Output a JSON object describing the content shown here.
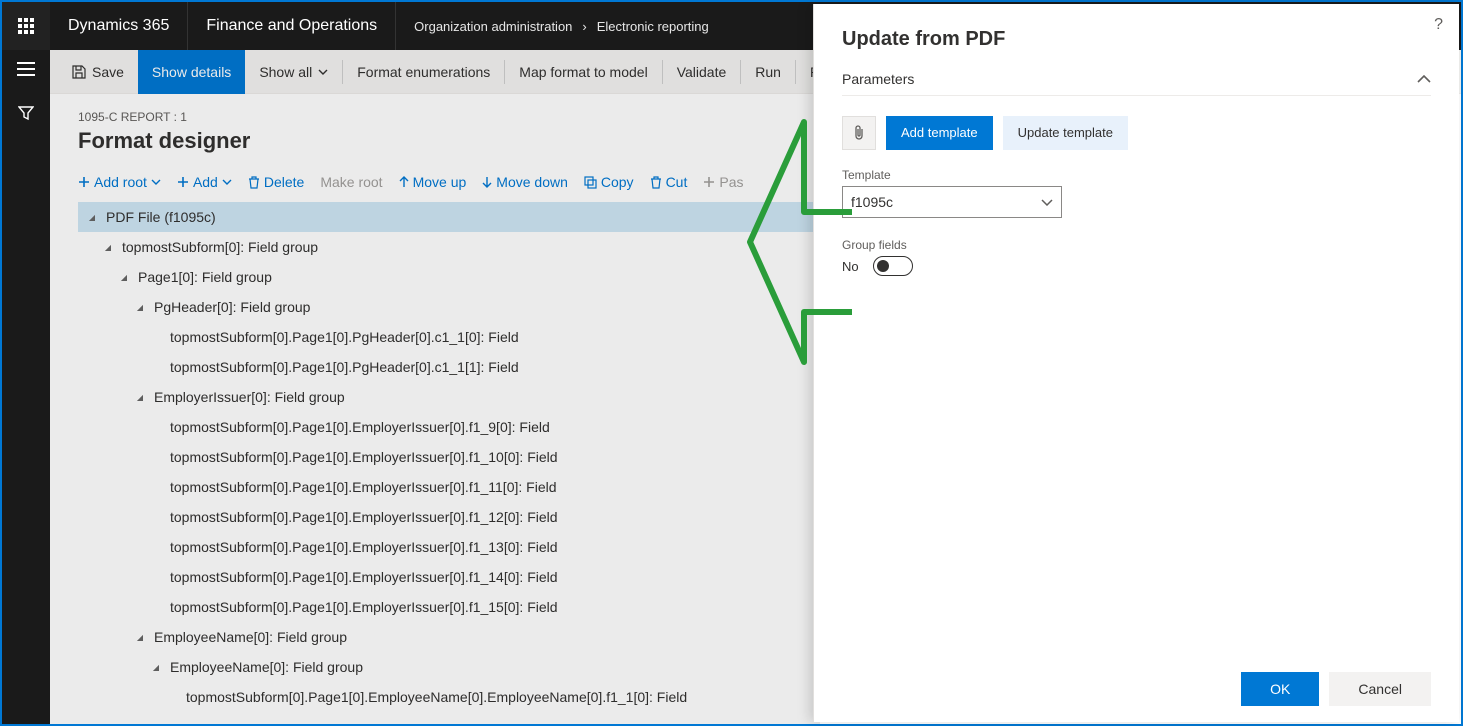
{
  "topbar": {
    "brand": "Dynamics 365",
    "module": "Finance and Operations",
    "breadcrumb": [
      "Organization administration",
      "Electronic reporting"
    ]
  },
  "cmdbar": {
    "save": "Save",
    "show_details": "Show details",
    "show_all": "Show all",
    "format_enum": "Format enumerations",
    "map_format": "Map format to model",
    "validate": "Validate",
    "run": "Run",
    "perf": "Performa"
  },
  "page": {
    "crumb": "1095-C REPORT : 1",
    "title": "Format designer"
  },
  "toolbar2": {
    "add_root": "Add root",
    "add": "Add",
    "delete": "Delete",
    "make_root": "Make root",
    "move_up": "Move up",
    "move_down": "Move down",
    "copy": "Copy",
    "cut": "Cut",
    "paste": "Pas"
  },
  "tree": [
    {
      "indent": 0,
      "caret": true,
      "label": "PDF File (f1095c)",
      "top": true
    },
    {
      "indent": 1,
      "caret": true,
      "label": "topmostSubform[0]: Field group"
    },
    {
      "indent": 2,
      "caret": true,
      "label": "Page1[0]: Field group"
    },
    {
      "indent": 3,
      "caret": true,
      "label": "PgHeader[0]: Field group"
    },
    {
      "indent": 4,
      "caret": false,
      "label": "topmostSubform[0].Page1[0].PgHeader[0].c1_1[0]: Field"
    },
    {
      "indent": 4,
      "caret": false,
      "label": "topmostSubform[0].Page1[0].PgHeader[0].c1_1[1]: Field"
    },
    {
      "indent": 3,
      "caret": true,
      "label": "EmployerIssuer[0]: Field group"
    },
    {
      "indent": 4,
      "caret": false,
      "label": "topmostSubform[0].Page1[0].EmployerIssuer[0].f1_9[0]: Field"
    },
    {
      "indent": 4,
      "caret": false,
      "label": "topmostSubform[0].Page1[0].EmployerIssuer[0].f1_10[0]: Field"
    },
    {
      "indent": 4,
      "caret": false,
      "label": "topmostSubform[0].Page1[0].EmployerIssuer[0].f1_11[0]: Field"
    },
    {
      "indent": 4,
      "caret": false,
      "label": "topmostSubform[0].Page1[0].EmployerIssuer[0].f1_12[0]: Field"
    },
    {
      "indent": 4,
      "caret": false,
      "label": "topmostSubform[0].Page1[0].EmployerIssuer[0].f1_13[0]: Field"
    },
    {
      "indent": 4,
      "caret": false,
      "label": "topmostSubform[0].Page1[0].EmployerIssuer[0].f1_14[0]: Field"
    },
    {
      "indent": 4,
      "caret": false,
      "label": "topmostSubform[0].Page1[0].EmployerIssuer[0].f1_15[0]: Field"
    },
    {
      "indent": 3,
      "caret": true,
      "label": "EmployeeName[0]: Field group"
    },
    {
      "indent": 4,
      "caret": true,
      "label": "EmployeeName[0]: Field group"
    },
    {
      "indent": 5,
      "caret": false,
      "label": "topmostSubform[0].Page1[0].EmployeeName[0].EmployeeName[0].f1_1[0]: Field"
    }
  ],
  "flyout": {
    "title": "Update from PDF",
    "section": "Parameters",
    "add_template": "Add template",
    "update_template": "Update template",
    "template_label": "Template",
    "template_value": "f1095c",
    "group_fields_label": "Group fields",
    "group_fields_value": "No",
    "ok": "OK",
    "cancel": "Cancel"
  }
}
